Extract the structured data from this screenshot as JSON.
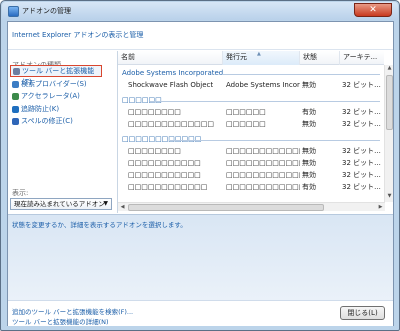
{
  "window": {
    "title": "アドオンの管理",
    "close_glyph": "✕"
  },
  "header": {
    "link": "Internet Explorer アドオンの表示と管理"
  },
  "sidebar": {
    "types_label": "アドオンの種類",
    "items": [
      {
        "label": "ツール バーと拡張機能(T)",
        "icon": "gear-icon",
        "color": "#6c7ea0",
        "selected": true
      },
      {
        "label": "検索プロバイダー(S)",
        "icon": "search-icon",
        "color": "#3b7cc4"
      },
      {
        "label": "アクセラレータ(A)",
        "icon": "accelerator-icon",
        "color": "#3c8a4b"
      },
      {
        "label": "追跡防止(K)",
        "icon": "tracking-protection-icon",
        "color": "#1f6fbf"
      },
      {
        "label": "スペルの修正(C)",
        "icon": "spelling-icon",
        "color": "#2f66b8"
      }
    ],
    "show_label": "表示:",
    "show_value": "現在読み込まれているアドオン",
    "show_arrow": "▼"
  },
  "list": {
    "columns": [
      "名前",
      "発行元",
      "状態",
      "アーキテ..."
    ],
    "sort_glyph": "▲",
    "groups": [
      {
        "name": "Adobe Systems Incorporated",
        "rows": [
          [
            "Shockwave Flash Object",
            "Adobe Systems Incor...",
            "無効",
            "32 ビット..."
          ]
        ]
      },
      {
        "name": "□□□□□□",
        "rows": [
          [
            "□□□□□□□□",
            "□□□□□□",
            "有効",
            "32 ビット..."
          ],
          [
            "□□□□□□□□□□□□□",
            "□□□□□□",
            "無効",
            "32 ビット..."
          ]
        ]
      },
      {
        "name": "□□□□□□□□□□□□",
        "rows": [
          [
            "□□□□□□□□",
            "□□□□□□□□□□□□",
            "無効",
            "32 ビット..."
          ],
          [
            "□□□□□□□□□□□",
            "□□□□□□□□□□□□",
            "無効",
            "32 ビット..."
          ],
          [
            "□□□□□□□□□□□",
            "□□□□□□□□□□□□",
            "無効",
            "32 ビット..."
          ],
          [
            "□□□□□□□□□□□□",
            "□□□□□□□□□□□□",
            "有効",
            "32 ビット..."
          ]
        ]
      }
    ],
    "scroll": {
      "up": "▲",
      "down": "▼",
      "left": "◀",
      "right": "▶"
    }
  },
  "details": {
    "status": "状態を変更するか、詳細を表示するアドオンを選択します。"
  },
  "footer": {
    "link1": "追加のツール バーと拡張機能を検索(F)...",
    "link2": "ツール バーと拡張機能の詳細(N)",
    "close_button": "閉じる(L)"
  }
}
